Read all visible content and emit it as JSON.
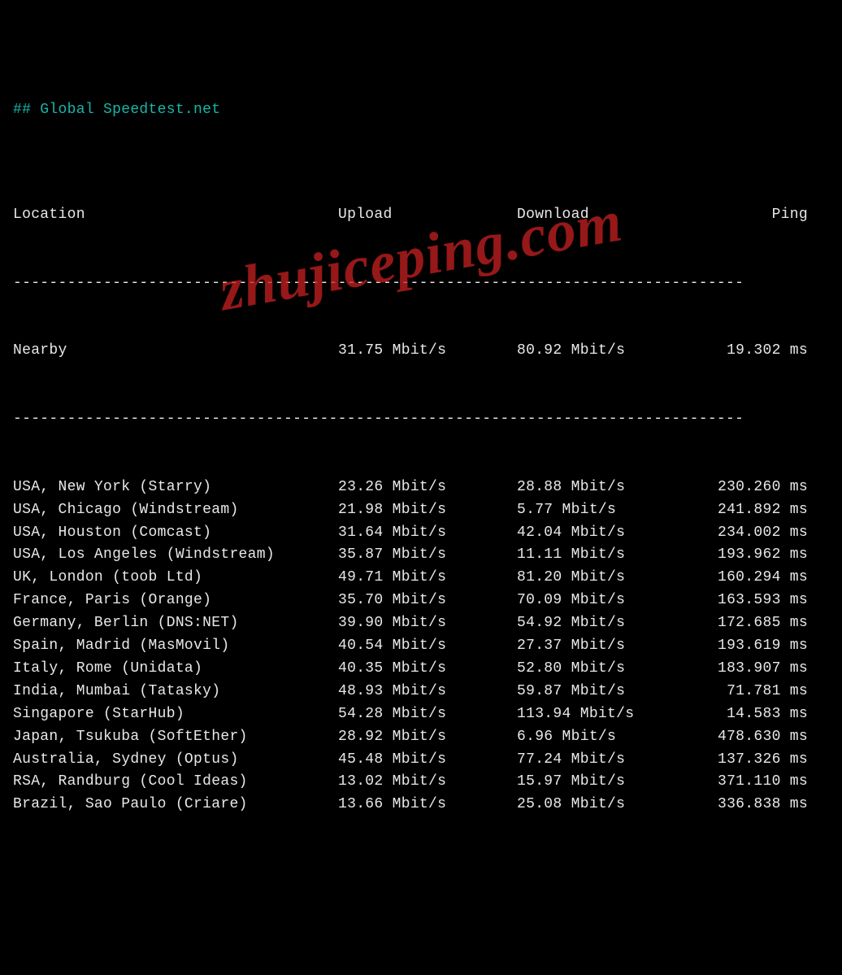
{
  "title": "## Global Speedtest.net",
  "headers": {
    "location": "Location",
    "upload": "Upload",
    "download": "Download",
    "ping": "Ping"
  },
  "separator": "---------------------------------------------------------------------------------",
  "nearby": {
    "label": "Nearby",
    "upload": "31.75 Mbit/s",
    "download": "80.92 Mbit/s",
    "ping": "19.302 ms"
  },
  "rows": [
    {
      "location": "USA, New York (Starry)",
      "upload": "23.26 Mbit/s",
      "download": "28.88 Mbit/s",
      "ping": "230.260 ms"
    },
    {
      "location": "USA, Chicago (Windstream)",
      "upload": "21.98 Mbit/s",
      "download": "5.77 Mbit/s",
      "ping": "241.892 ms"
    },
    {
      "location": "USA, Houston (Comcast)",
      "upload": "31.64 Mbit/s",
      "download": "42.04 Mbit/s",
      "ping": "234.002 ms"
    },
    {
      "location": "USA, Los Angeles (Windstream)",
      "upload": "35.87 Mbit/s",
      "download": "11.11 Mbit/s",
      "ping": "193.962 ms"
    },
    {
      "location": "UK, London (toob Ltd)",
      "upload": "49.71 Mbit/s",
      "download": "81.20 Mbit/s",
      "ping": "160.294 ms"
    },
    {
      "location": "France, Paris (Orange)",
      "upload": "35.70 Mbit/s",
      "download": "70.09 Mbit/s",
      "ping": "163.593 ms"
    },
    {
      "location": "Germany, Berlin (DNS:NET)",
      "upload": "39.90 Mbit/s",
      "download": "54.92 Mbit/s",
      "ping": "172.685 ms"
    },
    {
      "location": "Spain, Madrid (MasMovil)",
      "upload": "40.54 Mbit/s",
      "download": "27.37 Mbit/s",
      "ping": "193.619 ms"
    },
    {
      "location": "Italy, Rome (Unidata)",
      "upload": "40.35 Mbit/s",
      "download": "52.80 Mbit/s",
      "ping": "183.907 ms"
    },
    {
      "location": "India, Mumbai (Tatasky)",
      "upload": "48.93 Mbit/s",
      "download": "59.87 Mbit/s",
      "ping": "71.781 ms"
    },
    {
      "location": "Singapore (StarHub)",
      "upload": "54.28 Mbit/s",
      "download": "113.94 Mbit/s",
      "ping": "14.583 ms"
    },
    {
      "location": "Japan, Tsukuba (SoftEther)",
      "upload": "28.92 Mbit/s",
      "download": "6.96 Mbit/s",
      "ping": "478.630 ms"
    },
    {
      "location": "Australia, Sydney (Optus)",
      "upload": "45.48 Mbit/s",
      "download": "77.24 Mbit/s",
      "ping": "137.326 ms"
    },
    {
      "location": "RSA, Randburg (Cool Ideas)",
      "upload": "13.02 Mbit/s",
      "download": "15.97 Mbit/s",
      "ping": "371.110 ms"
    },
    {
      "location": "Brazil, Sao Paulo (Criare)",
      "upload": "13.66 Mbit/s",
      "download": "25.08 Mbit/s",
      "ping": "336.838 ms"
    }
  ],
  "watermark": "zhujiceping.com",
  "chart_data": {
    "type": "table",
    "title": "Global Speedtest.net",
    "columns": [
      "Location",
      "Upload (Mbit/s)",
      "Download (Mbit/s)",
      "Ping (ms)"
    ],
    "rows": [
      [
        "Nearby",
        31.75,
        80.92,
        19.302
      ],
      [
        "USA, New York (Starry)",
        23.26,
        28.88,
        230.26
      ],
      [
        "USA, Chicago (Windstream)",
        21.98,
        5.77,
        241.892
      ],
      [
        "USA, Houston (Comcast)",
        31.64,
        42.04,
        234.002
      ],
      [
        "USA, Los Angeles (Windstream)",
        35.87,
        11.11,
        193.962
      ],
      [
        "UK, London (toob Ltd)",
        49.71,
        81.2,
        160.294
      ],
      [
        "France, Paris (Orange)",
        35.7,
        70.09,
        163.593
      ],
      [
        "Germany, Berlin (DNS:NET)",
        39.9,
        54.92,
        172.685
      ],
      [
        "Spain, Madrid (MasMovil)",
        40.54,
        27.37,
        193.619
      ],
      [
        "Italy, Rome (Unidata)",
        40.35,
        52.8,
        183.907
      ],
      [
        "India, Mumbai (Tatasky)",
        48.93,
        59.87,
        71.781
      ],
      [
        "Singapore (StarHub)",
        54.28,
        113.94,
        14.583
      ],
      [
        "Japan, Tsukuba (SoftEther)",
        28.92,
        6.96,
        478.63
      ],
      [
        "Australia, Sydney (Optus)",
        45.48,
        77.24,
        137.326
      ],
      [
        "RSA, Randburg (Cool Ideas)",
        13.02,
        15.97,
        371.11
      ],
      [
        "Brazil, Sao Paulo (Criare)",
        13.66,
        25.08,
        336.838
      ]
    ]
  }
}
